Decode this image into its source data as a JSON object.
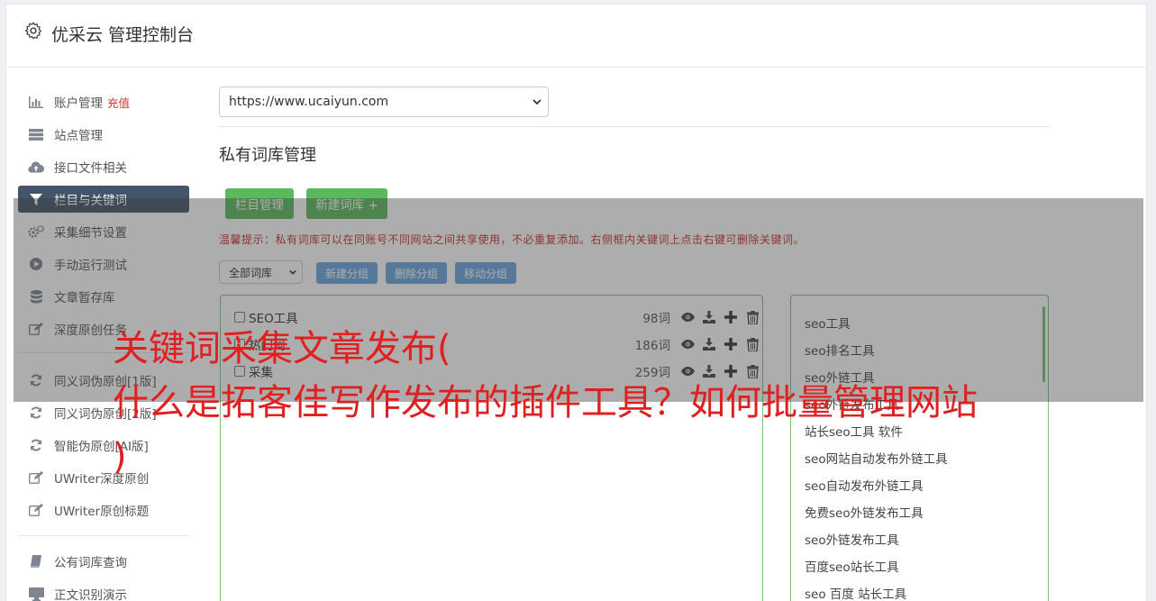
{
  "header": {
    "title": "优采云 管理控制台",
    "icon": "gear-icon"
  },
  "sidebar": {
    "items": [
      {
        "label": "账户管理",
        "badge": "充值",
        "icon": "bar-chart-icon"
      },
      {
        "label": "站点管理",
        "icon": "server-icon"
      },
      {
        "label": "接口文件相关",
        "icon": "cloud-upload-icon"
      },
      {
        "label": "栏目与关键词",
        "icon": "filter-icon",
        "active": true
      },
      {
        "label": "采集细节设置",
        "icon": "cogs-icon"
      },
      {
        "label": "手动运行测试",
        "icon": "play-circle-icon"
      },
      {
        "label": "文章暂存库",
        "icon": "database-icon"
      },
      {
        "label": "深度原创任务",
        "icon": "edit-icon"
      },
      {
        "label": "同义词伪原创[1版]",
        "icon": "refresh-icon"
      },
      {
        "label": "同义词伪原创[2版]",
        "icon": "refresh-icon"
      },
      {
        "label": "智能伪原创[AI版]",
        "icon": "refresh-icon"
      },
      {
        "label": "UWriter深度原创",
        "icon": "edit-icon"
      },
      {
        "label": "UWriter原创标题",
        "icon": "edit-icon"
      },
      {
        "label": "公有词库查询",
        "icon": "book-icon"
      },
      {
        "label": "正文识别演示",
        "icon": "monitor-icon"
      }
    ]
  },
  "main": {
    "site_select": "https://www.ucaiyun.com",
    "section_title": "私有词库管理",
    "buttons": {
      "column_manage": "栏目管理",
      "new_lexicon": "新建词库 +"
    },
    "tip": "温馨提示：私有词库可以在同账号不同网站之间共享使用，不必重复添加。右侧框内关键词上点击右键可删除关键词。",
    "group_select": "全部词库",
    "group_buttons": {
      "new": "新建分组",
      "delete": "删除分组",
      "move": "移动分组"
    },
    "lexicons": [
      {
        "name": "SEO工具",
        "count": "98词"
      },
      {
        "name": "热门词",
        "count": "186词"
      },
      {
        "name": "采集",
        "count": "259词"
      }
    ],
    "keywords": [
      "seo工具",
      "seo排名工具",
      "seo外链工具",
      "seo外链发布工具",
      "站长seo工具 软件",
      "seo网站自动发布外链工具",
      "seo自动发布外链工具",
      "免费seo外链发布工具",
      "seo外链发布工具",
      "百度seo站长工具",
      "seo 百度 站长工具"
    ]
  },
  "overlay": {
    "line1": "关键词采集文章发布(",
    "line2": "什么是拓客佳写作发布的插件工具？如何批量管理网站",
    "line3": ")"
  },
  "colors": {
    "accent_active": "#44546a",
    "green": "#5cb85c",
    "blue": "#6aa6dc",
    "headline": "#e02020"
  }
}
